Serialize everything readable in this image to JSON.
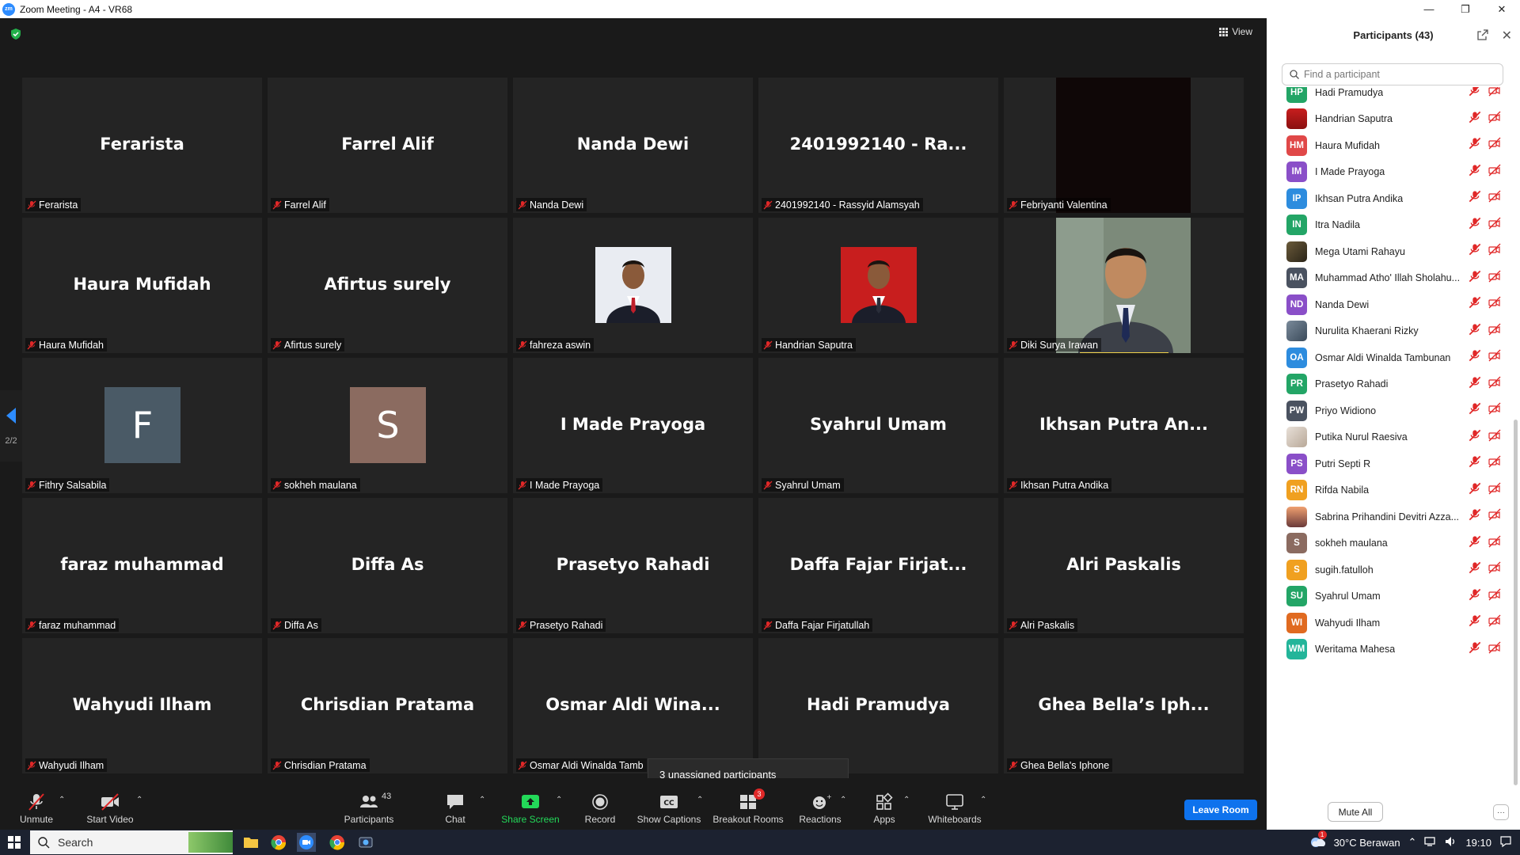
{
  "window": {
    "title": "Zoom Meeting - A4 - VR68",
    "logo_text": "zm"
  },
  "view_button": "View",
  "page_indicator": "2/2",
  "tiles": [
    {
      "type": "name",
      "big": "Ferarista",
      "label": "Ferarista"
    },
    {
      "type": "name",
      "big": "Farrel Alif",
      "label": "Farrel Alif"
    },
    {
      "type": "name",
      "big": "Nanda Dewi",
      "label": "Nanda Dewi"
    },
    {
      "type": "name",
      "big": "2401992140 - Ra...",
      "label": "2401992140 - Rassyid Alamsyah"
    },
    {
      "type": "dark",
      "big": "",
      "label": "Febriyanti Valentina"
    },
    {
      "type": "name",
      "big": "Haura Mufidah",
      "label": "Haura Mufidah"
    },
    {
      "type": "name",
      "big": "Afirtus surely",
      "label": "Afirtus surely"
    },
    {
      "type": "photo-blue",
      "big": "",
      "label": "fahreza aswin"
    },
    {
      "type": "photo-red",
      "big": "",
      "label": "Handrian Saputra"
    },
    {
      "type": "live",
      "big": "",
      "label": "Diki Surya Irawan"
    },
    {
      "type": "letter",
      "letter": "F",
      "color": "#4a5a66",
      "label": "Fithry Salsabila"
    },
    {
      "type": "letter",
      "letter": "S",
      "color": "#8b6b60",
      "label": "sokheh maulana"
    },
    {
      "type": "name",
      "big": "I Made Prayoga",
      "label": "I Made Prayoga"
    },
    {
      "type": "name",
      "big": "Syahrul Umam",
      "label": "Syahrul Umam"
    },
    {
      "type": "name",
      "big": "Ikhsan Putra An...",
      "label": "Ikhsan Putra Andika"
    },
    {
      "type": "name",
      "big": "faraz muhammad",
      "label": "faraz muhammad"
    },
    {
      "type": "name",
      "big": "Diffa As",
      "label": "Diffa As"
    },
    {
      "type": "name",
      "big": "Prasetyo Rahadi",
      "label": "Prasetyo Rahadi"
    },
    {
      "type": "name",
      "big": "Daffa Fajar Firjat...",
      "label": "Daffa Fajar Firjatullah"
    },
    {
      "type": "name",
      "big": "Alri Paskalis",
      "label": "Alri Paskalis"
    },
    {
      "type": "name",
      "big": "Wahyudi Ilham",
      "label": "Wahyudi Ilham"
    },
    {
      "type": "name",
      "big": "Chrisdian Pratama",
      "label": "Chrisdian Pratama"
    },
    {
      "type": "name",
      "big": "Osmar Aldi Wina...",
      "label": "Osmar Aldi Winalda Tamb"
    },
    {
      "type": "name",
      "big": "Hadi Pramudya",
      "label": ""
    },
    {
      "type": "name",
      "big": "Ghea Bella’s Iph...",
      "label": "Ghea Bella's Iphone"
    }
  ],
  "tooltip": "3 unassigned participants",
  "toolbar": {
    "unmute": "Unmute",
    "start_video": "Start Video",
    "participants": "Participants",
    "participants_count": "43",
    "chat": "Chat",
    "share_screen": "Share Screen",
    "record": "Record",
    "show_captions": "Show Captions",
    "breakout_rooms": "Breakout Rooms",
    "breakout_badge": "3",
    "reactions": "Reactions",
    "apps": "Apps",
    "whiteboards": "Whiteboards",
    "leave_room": "Leave Room"
  },
  "panel": {
    "title": "Participants (43)",
    "search_placeholder": "Find a participant",
    "mute_all": "Mute All",
    "more": "···",
    "participants": [
      {
        "initials": "HP",
        "name": "Hadi Pramudya",
        "color": "#23a566",
        "photo": ""
      },
      {
        "initials": "",
        "name": "Handrian Saputra",
        "color": "#b53030",
        "photo": "red"
      },
      {
        "initials": "HM",
        "name": "Haura Mufidah",
        "color": "#e04848",
        "photo": ""
      },
      {
        "initials": "IM",
        "name": "I Made Prayoga",
        "color": "#8a4fc8",
        "photo": ""
      },
      {
        "initials": "IP",
        "name": "Ikhsan Putra Andika",
        "color": "#2d8cde",
        "photo": ""
      },
      {
        "initials": "IN",
        "name": "Itra Nadila",
        "color": "#23a566",
        "photo": ""
      },
      {
        "initials": "",
        "name": "Mega Utami Rahayu",
        "color": "#5a4a30",
        "photo": "dark"
      },
      {
        "initials": "MA",
        "name": "Muhammad Atho' Illah Sholahu...",
        "color": "#4a5260",
        "photo": ""
      },
      {
        "initials": "ND",
        "name": "Nanda Dewi",
        "color": "#8a4fc8",
        "photo": ""
      },
      {
        "initials": "",
        "name": "Nurulita Khaerani Rizky",
        "color": "#6a7a8a",
        "photo": "grey"
      },
      {
        "initials": "OA",
        "name": "Osmar Aldi Winalda Tambunan",
        "color": "#2d8cde",
        "photo": ""
      },
      {
        "initials": "PR",
        "name": "Prasetyo Rahadi",
        "color": "#23a566",
        "photo": ""
      },
      {
        "initials": "PW",
        "name": "Priyo Widiono",
        "color": "#4a5260",
        "photo": ""
      },
      {
        "initials": "",
        "name": "Putika Nurul Raesiva",
        "color": "#d8c8b8",
        "photo": "light"
      },
      {
        "initials": "PS",
        "name": "Putri Septi R",
        "color": "#8a4fc8",
        "photo": ""
      },
      {
        "initials": "RN",
        "name": "Rifda Nabila",
        "color": "#f0a020",
        "photo": ""
      },
      {
        "initials": "",
        "name": "Sabrina Prihandini Devitri Azza...",
        "color": "#c07050",
        "photo": "sunset"
      },
      {
        "initials": "S",
        "name": "sokheh maulana",
        "color": "#8b6b60",
        "photo": ""
      },
      {
        "initials": "S",
        "name": "sugih.fatulloh",
        "color": "#f0a020",
        "photo": ""
      },
      {
        "initials": "SU",
        "name": "Syahrul Umam",
        "color": "#23a566",
        "photo": ""
      },
      {
        "initials": "WI",
        "name": "Wahyudi Ilham",
        "color": "#e06a20",
        "photo": ""
      },
      {
        "initials": "WM",
        "name": "Weritama Mahesa",
        "color": "#23b59a",
        "photo": ""
      }
    ]
  },
  "taskbar": {
    "search": "Search",
    "weather": "30°C  Berawan",
    "time": "19:10",
    "weather_badge": "1"
  },
  "colors": {
    "accent": "#0e72ed",
    "share_green": "#23d959",
    "mic_off_red": "#e02828",
    "speaker_highlight": "#f0d24a"
  }
}
